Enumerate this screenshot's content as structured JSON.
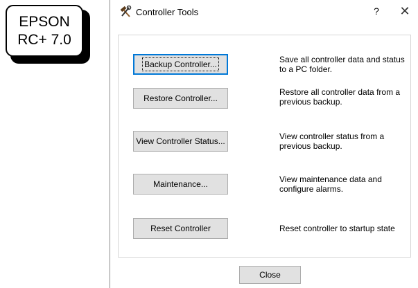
{
  "badge": {
    "line1": "EPSON",
    "line2": "RC+ 7.0"
  },
  "window": {
    "title": "Controller Tools",
    "help": "?",
    "close_glyph": "✕"
  },
  "actions": [
    {
      "label": "Backup Controller...",
      "description": "Save all controller data and status to a PC folder."
    },
    {
      "label": "Restore Controller...",
      "description": "Restore all controller data from a previous backup."
    },
    {
      "label": "View Controller Status...",
      "description": "View controller status from a previous backup."
    },
    {
      "label": "Maintenance...",
      "description": "View maintenance data and configure alarms."
    },
    {
      "label": "Reset Controller",
      "description": "Reset controller to startup state"
    }
  ],
  "footer": {
    "close_label": "Close"
  },
  "icons": {
    "title": "tools-icon"
  },
  "colors": {
    "focus": "#0078d7",
    "button_face": "#e1e1e1"
  }
}
